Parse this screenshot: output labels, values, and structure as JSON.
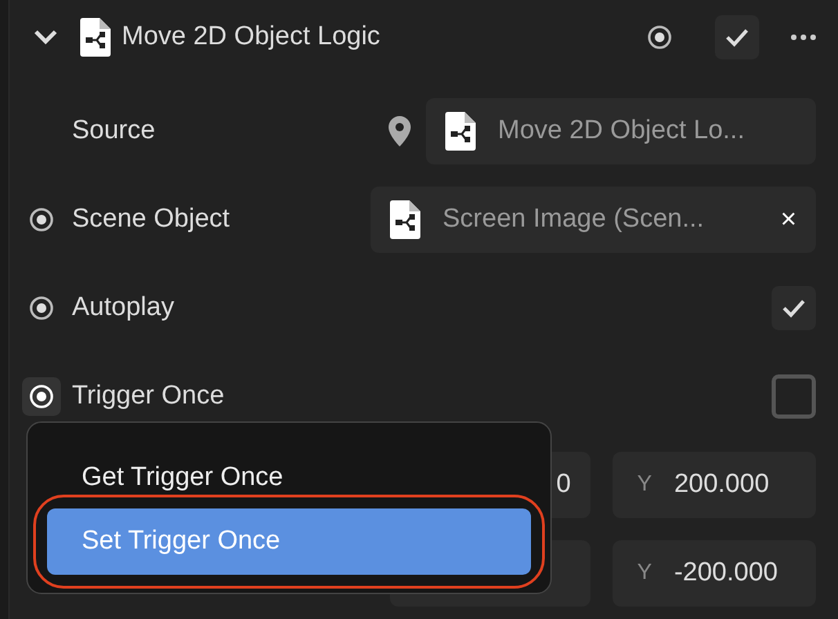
{
  "component": {
    "title": "Move 2D Object Logic",
    "expanded": true,
    "enabled": true
  },
  "properties": [
    {
      "kind": "reference",
      "label": "Source",
      "value": "Move 2D Object Lo..."
    },
    {
      "kind": "reference",
      "label": "Scene Object",
      "value": "Screen Image (Scen...",
      "clear_symbol": "×",
      "link_active": false
    },
    {
      "kind": "checkbox",
      "label": "Autoplay",
      "link_active": false,
      "checked": true
    },
    {
      "kind": "checkbox",
      "label": "Trigger Once",
      "link_active": true,
      "checked": false
    },
    {
      "kind": "vector",
      "x_value": "0",
      "y_label": "Y",
      "y_value": "200.000"
    },
    {
      "kind": "vector",
      "y_label": "Y",
      "y_value": "-200.000"
    }
  ],
  "context_menu": {
    "items": [
      {
        "label": "Get Trigger Once",
        "selected": false,
        "outlined": false
      },
      {
        "label": "Set Trigger Once",
        "selected": true,
        "outlined": true
      }
    ]
  }
}
